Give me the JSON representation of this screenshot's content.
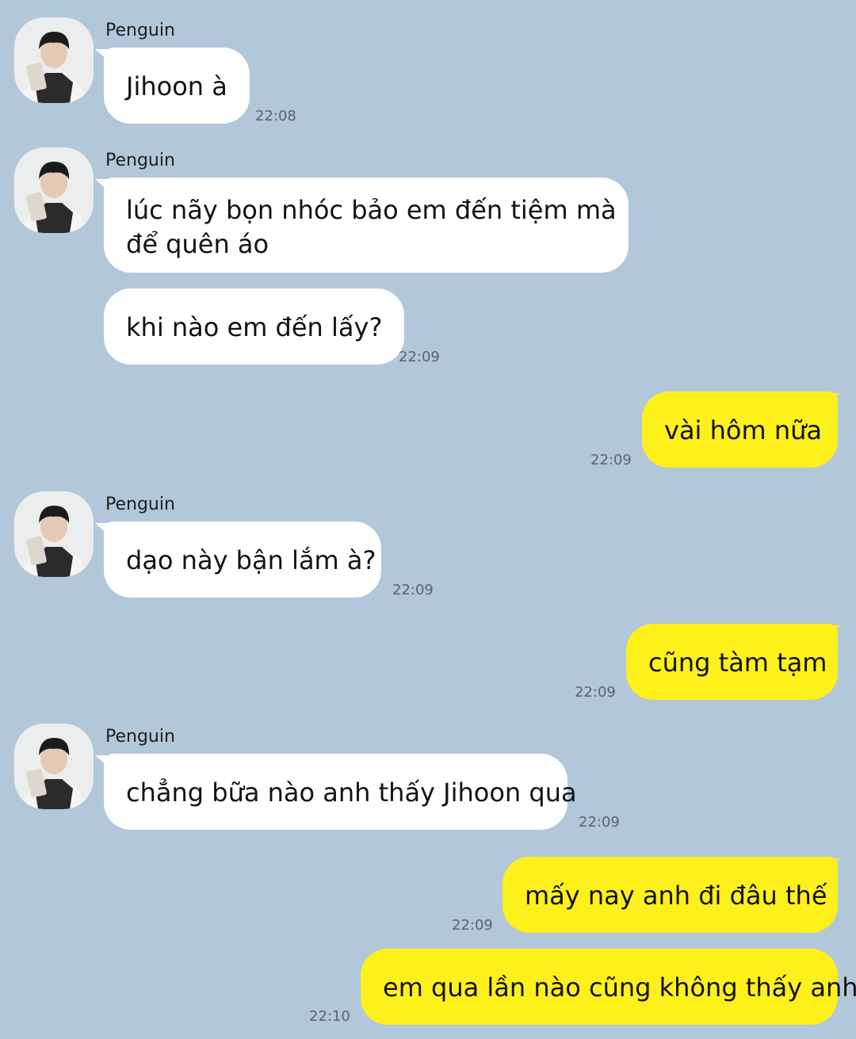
{
  "theme": {
    "background": "#b2c7d9",
    "incoming_bubble": "#ffffff",
    "outgoing_bubble": "#fef01b"
  },
  "avatar_icon": "user-photo",
  "groups": [
    {
      "sender": "Penguin",
      "messages": [
        {
          "text": "Jihoon à",
          "time": "22:08"
        }
      ]
    },
    {
      "sender": "Penguin",
      "messages": [
        {
          "text": "lúc nãy bọn nhóc bảo em đến tiệm mà",
          "text2": "để quên áo"
        },
        {
          "text": "khi nào em đến lấy?",
          "time": "22:09"
        }
      ]
    },
    {
      "outgoing": true,
      "messages": [
        {
          "text": "vài hôm nữa",
          "time": "22:09"
        }
      ]
    },
    {
      "sender": "Penguin",
      "messages": [
        {
          "text": "dạo này bận lắm à?",
          "time": "22:09"
        }
      ]
    },
    {
      "outgoing": true,
      "messages": [
        {
          "text": "cũng tàm tạm",
          "time": "22:09"
        }
      ]
    },
    {
      "sender": "Penguin",
      "messages": [
        {
          "text": "chẳng bữa nào anh thấy Jihoon qua",
          "time": "22:09"
        }
      ]
    },
    {
      "outgoing": true,
      "messages": [
        {
          "text": "mấy nay anh đi đâu thế",
          "time": "22:09"
        },
        {
          "text": "em qua lần nào cũng không thấy anh",
          "time": "22:10"
        }
      ]
    }
  ]
}
